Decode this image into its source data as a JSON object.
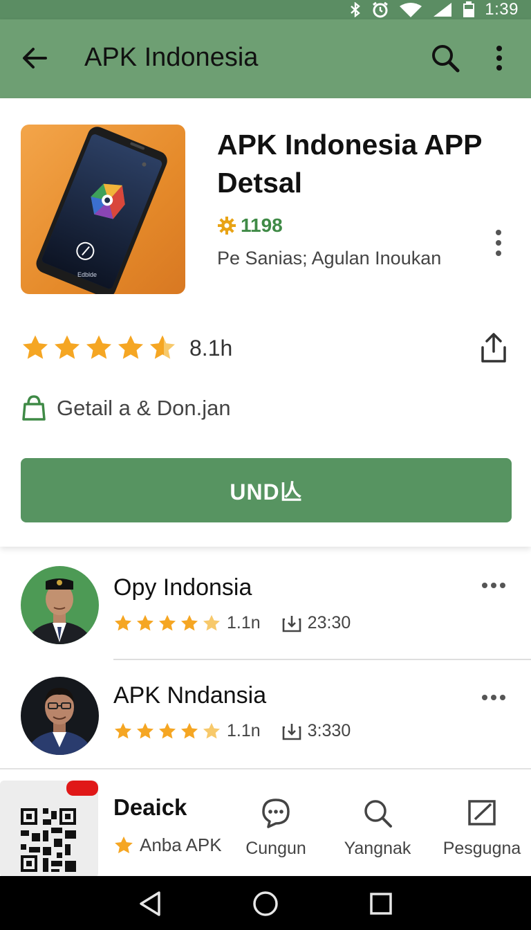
{
  "status_bar": {
    "time": "1:39",
    "icons": [
      "bluetooth-icon",
      "alarm-icon",
      "wifi-icon",
      "signal-icon",
      "battery-icon"
    ]
  },
  "app_bar": {
    "title": "APK Indonesia",
    "icons": [
      "back-arrow-icon",
      "search-icon",
      "more-vert-icon"
    ]
  },
  "app_detail": {
    "name": "APK Indonesia APP Detsal",
    "stat_value": "1198",
    "publisher": "Pe Sanias; Agulan Inoukan",
    "rating_text": "8.1h",
    "rating_stars": 4.5,
    "info_text": "Getail a & Don.jan",
    "install_label": "UND亾",
    "icon_screen_label": "Edblde"
  },
  "list": [
    {
      "title": "Opy Indonsia",
      "stars": 4.5,
      "rating": "1.1n",
      "downloads": "23:30"
    },
    {
      "title": "APK Nndansia",
      "stars": 4.5,
      "rating": "1.1n",
      "downloads": "3:330"
    }
  ],
  "bottom_nav": {
    "home": {
      "title": "Deaick",
      "subtitle": "Anba APK"
    },
    "items": [
      {
        "label": "Cungun",
        "icon": "chat-icon"
      },
      {
        "label": "Yangnak",
        "icon": "search-icon"
      },
      {
        "label": "Pesgugna",
        "icon": "edit-icon"
      }
    ]
  },
  "colors": {
    "status_bar": "#5b8d63",
    "app_bar": "#6e9f73",
    "install_button": "#579461",
    "star": "#f5a623",
    "accent_green": "#3f8a46",
    "badge_red": "#e01818"
  }
}
